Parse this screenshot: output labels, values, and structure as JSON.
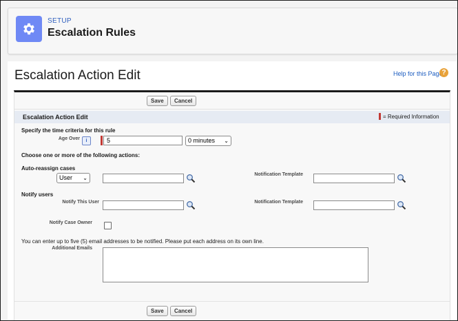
{
  "header": {
    "eyebrow": "SETUP",
    "title": "Escalation Rules",
    "icon": "gear-icon",
    "icon_color": "#6f89f5"
  },
  "page": {
    "title": "Escalation Action Edit",
    "help_link": "Help for this Page",
    "help_icon": "?"
  },
  "buttons": {
    "save": "Save",
    "cancel": "Cancel"
  },
  "section": {
    "title": "Escalation Action Edit",
    "required_info": "= Required Information",
    "required_color": "#c23934"
  },
  "time_criteria": {
    "heading": "Specify the time criteria for this rule",
    "age_over_label": "Age Over",
    "age_over_value": "5",
    "minutes_value": "0 minutes"
  },
  "actions": {
    "heading": "Choose one or more of the following actions:"
  },
  "reassign": {
    "heading": "Auto-reassign cases",
    "owner_type": "User",
    "assignee_value": "",
    "notification_template_label": "Notification Template",
    "notification_template_value": ""
  },
  "notify": {
    "heading": "Notify users",
    "notify_user_label": "Notify This User",
    "notify_user_value": "",
    "notification_template_label": "Notification Template",
    "notification_template_value": "",
    "notify_owner_label": "Notify Case Owner",
    "notify_owner_checked": false
  },
  "emails": {
    "instructions": "You can enter up to five (5) email addresses to be notified. Please put each address on its own line.",
    "label": "Additional Emails",
    "value": ""
  }
}
